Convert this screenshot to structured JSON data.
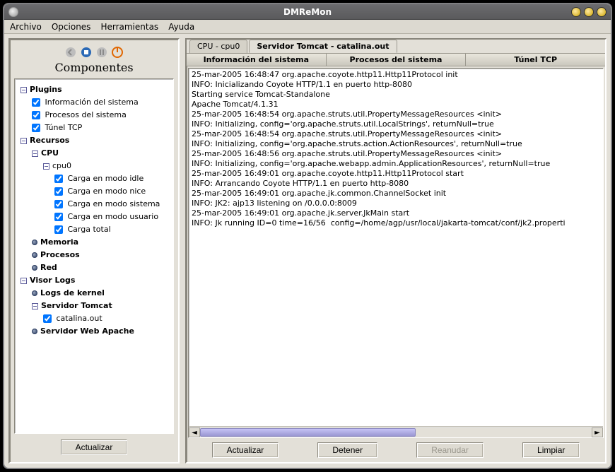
{
  "window": {
    "title": "DMReMon"
  },
  "menu": {
    "items": [
      "Archivo",
      "Opciones",
      "Herramientas",
      "Ayuda"
    ]
  },
  "left": {
    "title": "Componentes",
    "update_btn": "Actualizar",
    "tree": {
      "plugins": {
        "label": "Plugins",
        "items": [
          {
            "label": "Información del sistema",
            "checked": true
          },
          {
            "label": "Procesos del sistema",
            "checked": true
          },
          {
            "label": "Túnel TCP",
            "checked": true
          }
        ]
      },
      "recursos": {
        "label": "Recursos",
        "cpu": {
          "label": "CPU",
          "cpu0": {
            "label": "cpu0",
            "items": [
              {
                "label": "Carga en modo idle",
                "checked": true
              },
              {
                "label": "Carga en modo nice",
                "checked": true
              },
              {
                "label": "Carga en modo sistema",
                "checked": true
              },
              {
                "label": "Carga en modo usuario",
                "checked": true
              },
              {
                "label": "Carga total",
                "checked": true
              }
            ]
          }
        },
        "memoria": {
          "label": "Memoria"
        },
        "procesos": {
          "label": "Procesos"
        },
        "red": {
          "label": "Red"
        }
      },
      "visor": {
        "label": "Visor Logs",
        "kernel": {
          "label": "Logs de kernel"
        },
        "tomcat": {
          "label": "Servidor Tomcat",
          "items": [
            {
              "label": "catalina.out",
              "checked": true
            }
          ]
        },
        "apache": {
          "label": "Servidor Web Apache"
        }
      }
    }
  },
  "right": {
    "tabs": [
      {
        "label": "CPU - cpu0",
        "active": false
      },
      {
        "label": "Servidor Tomcat - catalina.out",
        "active": true
      }
    ],
    "subtabs": [
      "Información del sistema",
      "Procesos del sistema",
      "Túnel TCP"
    ],
    "log_lines": [
      "25-mar-2005 16:48:47 org.apache.coyote.http11.Http11Protocol init",
      "INFO: Inicializando Coyote HTTP/1.1 en puerto http-8080",
      "Starting service Tomcat-Standalone",
      "Apache Tomcat/4.1.31",
      "25-mar-2005 16:48:54 org.apache.struts.util.PropertyMessageResources <init>",
      "INFO: Initializing, config='org.apache.struts.util.LocalStrings', returnNull=true",
      "25-mar-2005 16:48:54 org.apache.struts.util.PropertyMessageResources <init>",
      "INFO: Initializing, config='org.apache.struts.action.ActionResources', returnNull=true",
      "25-mar-2005 16:48:56 org.apache.struts.util.PropertyMessageResources <init>",
      "INFO: Initializing, config='org.apache.webapp.admin.ApplicationResources', returnNull=true",
      "25-mar-2005 16:49:01 org.apache.coyote.http11.Http11Protocol start",
      "INFO: Arrancando Coyote HTTP/1.1 en puerto http-8080",
      "25-mar-2005 16:49:01 org.apache.jk.common.ChannelSocket init",
      "INFO: JK2: ajp13 listening on /0.0.0.0:8009",
      "25-mar-2005 16:49:01 org.apache.jk.server.JkMain start",
      "INFO: Jk running ID=0 time=16/56  config=/home/agp/usr/local/jakarta-tomcat/conf/jk2.properti"
    ],
    "buttons": {
      "actualizar": "Actualizar",
      "detener": "Detener",
      "reanudar": "Reanudar",
      "limpiar": "Limpiar"
    }
  }
}
